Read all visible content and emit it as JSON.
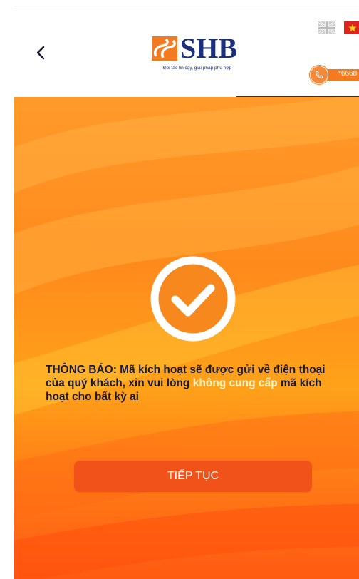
{
  "header": {
    "brand_name": "SHB",
    "brand_tagline": "Đối tác tin cậy, giải pháp phù hợp",
    "hotline_label": "*6668",
    "language_options": [
      "English",
      "Tiếng Việt"
    ]
  },
  "notice": {
    "prefix": "THÔNG BÁO: Mã kích hoạt sẽ được gửi về điện thoại của quý khách, xin vui lòng ",
    "highlight": "không cung cấp",
    "suffix": " mã kích hoạt cho bất kỳ ai"
  },
  "actions": {
    "continue_label": "TIẾP TỤC"
  },
  "colors": {
    "brand_orange": "#f47a1f",
    "brand_navy": "#1c2f7d",
    "button_bg": "#f0521a",
    "highlight_text": "#fff4c2"
  },
  "icons": {
    "back": "chevron-left-icon",
    "success": "check-circle-icon",
    "hotline": "phone-icon",
    "lang_en": "uk-flag-icon",
    "lang_vi": "vn-flag-icon"
  }
}
